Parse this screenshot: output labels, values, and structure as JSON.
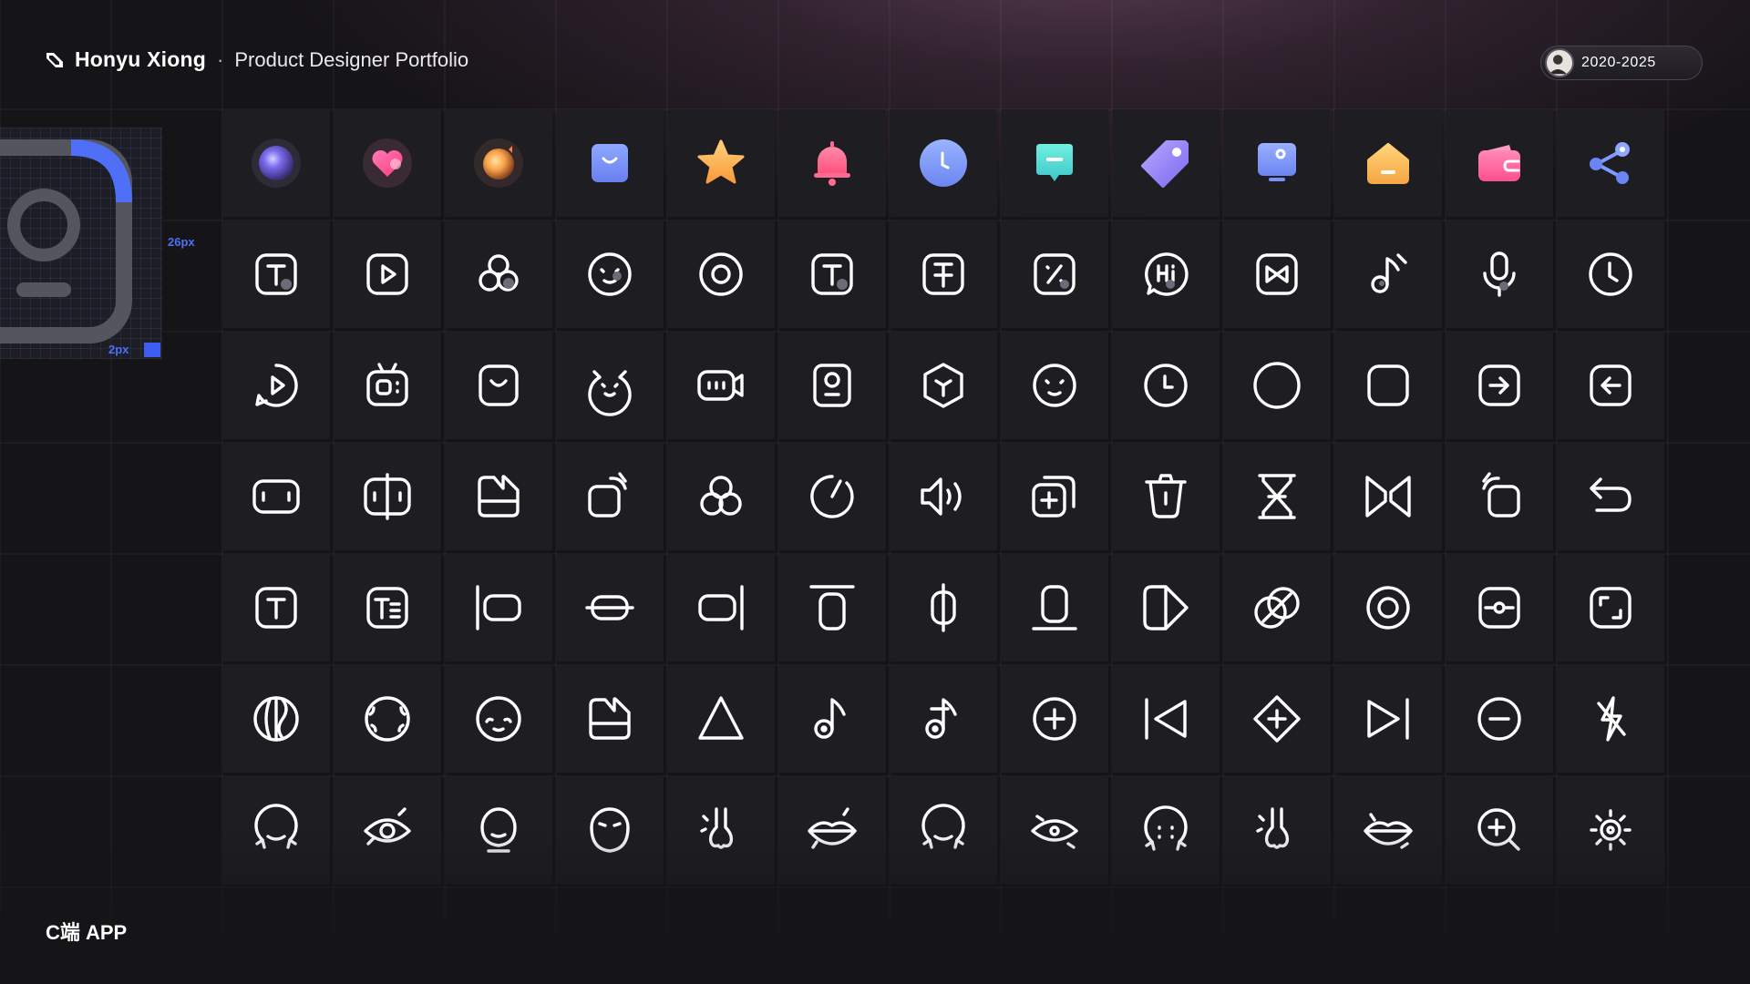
{
  "header": {
    "brand_name": "Honyu Xiong",
    "separator": "·",
    "subtitle": "Product Designer Portfolio",
    "brand_icon": "honyu-logo-icon"
  },
  "year_badge": {
    "label": "2020-2025",
    "avatar_icon": "avatar-icon"
  },
  "spec": {
    "size_label": "26px",
    "stroke_label": "2px",
    "accent": "#4e6ff6"
  },
  "footer": {
    "label": "C端 APP"
  },
  "colors": {
    "background": "#151417",
    "cell": "#1e1d21",
    "stroke": "#ffffff"
  },
  "icons": {
    "row1": [
      "orb-purple-icon",
      "heart-icon",
      "orb-orange-icon",
      "shopping-bag-icon",
      "star-icon",
      "bell-icon",
      "clock-icon",
      "chat-bubble-icon",
      "tag-icon",
      "monitor-icon",
      "home-icon",
      "wallet-icon",
      "share-icon"
    ],
    "row2": [
      "text-box-icon",
      "play-box-icon",
      "circles-icon",
      "face-box-icon",
      "target-icon",
      "text-box-icon",
      "text-strike-icon",
      "percent-box-icon",
      "hi-bubble-icon",
      "bowtie-box-icon",
      "music-note-icon",
      "microphone-icon",
      "clock-icon"
    ],
    "row3": [
      "play-bubble-icon",
      "tv-icon",
      "smile-box-icon",
      "cat-face-icon",
      "video-camera-icon",
      "portrait-icon",
      "cube-icon",
      "face-icon",
      "clock-icon",
      "circle-icon",
      "rounded-square-icon",
      "arrow-right-box-icon",
      "arrow-left-box-icon"
    ],
    "row4": [
      "battery-box-icon",
      "split-box-icon",
      "gallery-icon",
      "rotate-right-icon",
      "circles-icon",
      "timer-icon",
      "volume-icon",
      "add-copy-icon",
      "trash-icon",
      "hourglass-icon",
      "bowtie-icon",
      "rotate-left-icon",
      "undo-icon"
    ],
    "row5": [
      "text-box-icon",
      "text-list-icon",
      "align-left-icon",
      "align-center-horizontal-icon",
      "align-right-icon",
      "align-top-icon",
      "align-center-vertical-icon",
      "align-bottom-icon",
      "flip-icon",
      "intersect-icon",
      "target-icon",
      "tracking-icon",
      "crop-icon"
    ],
    "row6": [
      "contrast-icon",
      "face-outline-icon",
      "face-smile-icon",
      "gallery-icon",
      "triangle-icon",
      "music-note-icon",
      "music-note-strike-icon",
      "plus-circle-icon",
      "skip-back-icon",
      "plus-diamond-icon",
      "skip-forward-icon",
      "minus-circle-icon",
      "flash-off-icon"
    ],
    "row7": [
      "face-outline-icon",
      "eye-icon",
      "face-slim-icon",
      "face-sleep-icon",
      "nose-icon",
      "lips-icon",
      "face-outline-icon",
      "eye-icon",
      "face-dots-icon",
      "nose-icon",
      "lips-icon",
      "zoom-in-icon",
      "brightness-icon"
    ]
  }
}
